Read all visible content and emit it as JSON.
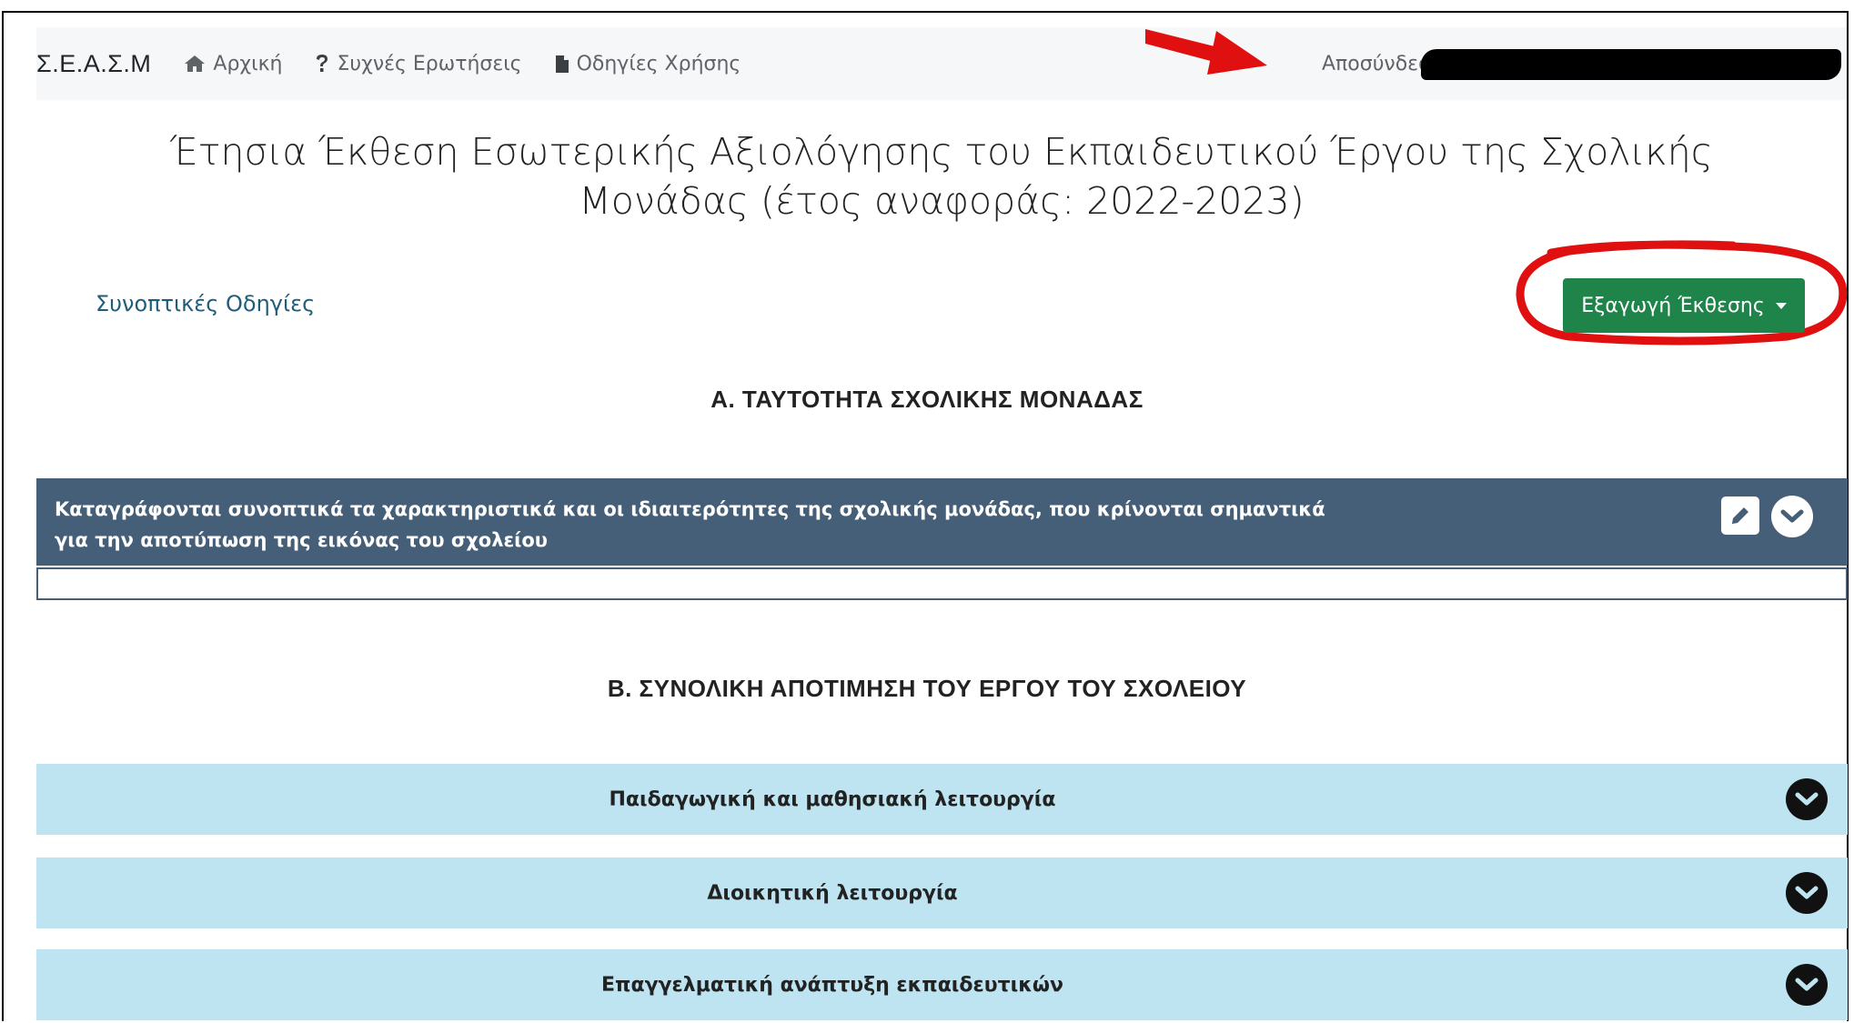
{
  "navbar": {
    "brand": "Σ.Ε.Α.Σ.Μ",
    "links": [
      {
        "label": "Αρχική",
        "icon": "home-icon"
      },
      {
        "label": "Συχνές Ερωτήσεις",
        "icon": "question-icon"
      },
      {
        "label": "Οδηγίες Χρήσης",
        "icon": "document-icon"
      }
    ],
    "logout_label": "Αποσύνδεση"
  },
  "page": {
    "title": "Έτησια Έκθεση Εσωτερικής Αξιολόγησης του Εκπαιδευτικού Έργου της Σχολικής Μονάδας (έτος αναφοράς: 2022-2023)",
    "instructions_link": "Συνοπτικές Οδηγίες",
    "export_button": "Εξαγωγή Έκθεσης"
  },
  "section_a": {
    "heading": "Α. ΤΑΥΤΟΤΗΤΑ ΣΧΟΛΙΚΗΣ ΜΟΝΑΔΑΣ",
    "panel_text": "Καταγράφονται συνοπτικά τα χαρακτηριστικά και οι ιδιαιτερότητες της σχολικής μονάδας, που κρίνονται σημαντικά για την αποτύπωση της εικόνας του σχολείου",
    "panel_body": ""
  },
  "section_b": {
    "heading": "Β. ΣΥΝΟΛΙΚΗ ΑΠΟΤΙΜΗΣΗ ΤΟΥ ΕΡΓΟΥ ΤΟΥ ΣΧΟΛΕΙΟΥ",
    "panels": [
      {
        "label": "Παιδαγωγική και μαθησιακή λειτουργία"
      },
      {
        "label": "Διοικητική λειτουργία"
      },
      {
        "label": "Επαγγελματική ανάπτυξη εκπαιδευτικών"
      }
    ]
  },
  "colors": {
    "navbar_bg": "#f6f7f8",
    "export_button": "#1e8449",
    "panel_a_bg": "#465f78",
    "panel_b_bg": "#bde4f0",
    "annotation": "#e01010"
  }
}
